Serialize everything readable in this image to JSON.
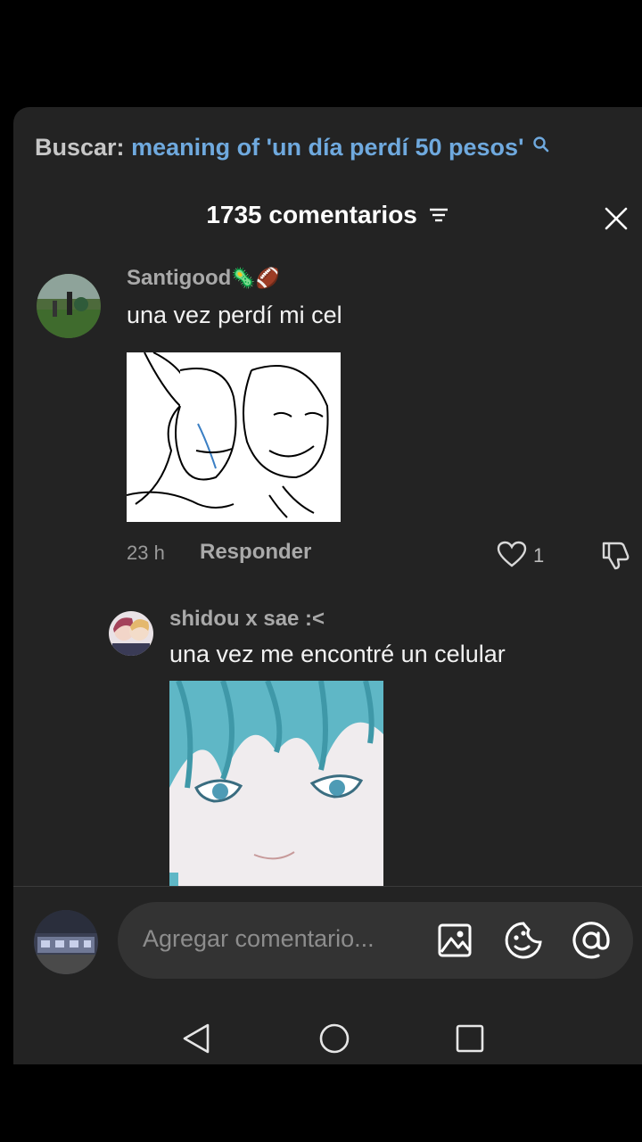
{
  "search": {
    "label": "Buscar:",
    "query": "meaning of 'un día perdí 50 pesos'"
  },
  "header": {
    "title": "1735 comentarios"
  },
  "comments": [
    {
      "username": "Santigood",
      "text": "una vez perdí mi cel",
      "time": "23 h",
      "reply_label": "Responder",
      "likes": "1"
    },
    {
      "username": "shidou x sae :<",
      "text": "una vez me encontré un celular"
    }
  ],
  "composer": {
    "placeholder": "Agregar comentario..."
  },
  "icons": {
    "search": "search-icon",
    "filter": "filter-icon",
    "close": "close-icon",
    "like": "heart-icon",
    "dislike": "dislike-icon",
    "image": "image-icon",
    "emoji": "emoji-icon",
    "mention": "at-icon",
    "nav_back": "back-triangle-icon",
    "nav_home": "home-circle-icon",
    "nav_recents": "recents-square-icon"
  },
  "colors": {
    "background": "#000000",
    "sheet": "#232323",
    "search_query": "#6fa9de"
  }
}
